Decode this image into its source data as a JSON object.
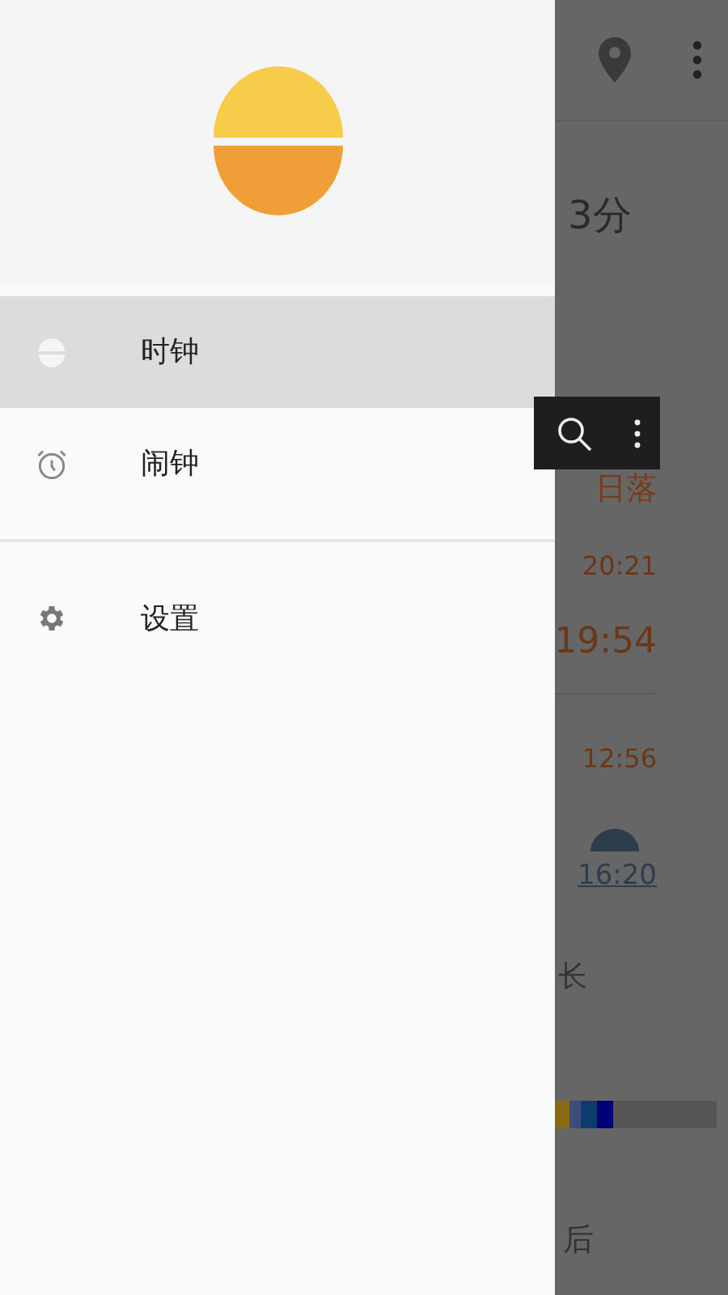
{
  "drawer": {
    "items": [
      {
        "label": "时钟",
        "kind": "clock",
        "selected": true
      },
      {
        "label": "闹钟",
        "kind": "alarm",
        "selected": false
      }
    ],
    "settings": {
      "label": "设置"
    }
  },
  "background": {
    "duration_text": "3分",
    "sunset_label": "日落",
    "sunset_times": [
      "20:21",
      "19:54"
    ],
    "noon_time": "12:56",
    "twilight_time": "16:20",
    "day_length_text": "长",
    "after_text": "后"
  }
}
